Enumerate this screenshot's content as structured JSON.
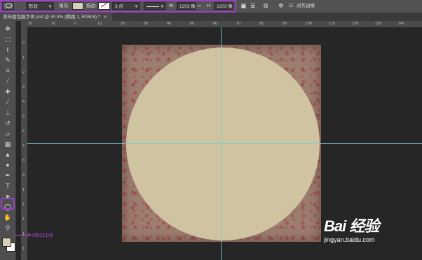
{
  "options_bar": {
    "shape_mode": "形状",
    "fill_label": "填充:",
    "stroke_label": "描边:",
    "stroke_size": "3 点",
    "width_label": "W:",
    "width_value": "1203 像",
    "link_icon": "link-icon",
    "height_label": "H:",
    "height_value": "1203 像",
    "align_edges_label": "对齐边缘",
    "fill_color": "#d8d1b9",
    "highlight_color": "#9b3fc4"
  },
  "document_tab": {
    "title": "美味面包圈字体.psd @ 40.3% (椭圆 1, RGB/8) *"
  },
  "ruler": {
    "h_ticks": [
      "20",
      "10",
      "0",
      "10",
      "20",
      "30",
      "40",
      "50",
      "60",
      "70",
      "80",
      "90",
      "100",
      "110",
      "120",
      "130",
      "140"
    ],
    "v_ticks": [
      "0",
      "1",
      "2",
      "3",
      "4",
      "5",
      "6",
      "7",
      "8",
      "9",
      "1",
      "1",
      "1",
      "1",
      "1"
    ]
  },
  "toolbar": {
    "tools": [
      "move-tool",
      "marquee-tool",
      "lasso-tool",
      "quick-select-tool",
      "crop-tool",
      "eyedropper-tool",
      "healing-brush-tool",
      "brush-tool",
      "clone-stamp-tool",
      "history-brush-tool",
      "eraser-tool",
      "gradient-tool",
      "blur-tool",
      "dodge-tool",
      "pen-tool",
      "type-tool",
      "path-select-tool",
      "ellipse-tool",
      "hand-tool",
      "zoom-tool"
    ],
    "selected_tool": "ellipse-tool",
    "foreground_color": "#d8d1b9",
    "background_color": "#ffffff"
  },
  "annotation": {
    "text": "#d8d1b9",
    "color": "#b03fd0"
  },
  "canvas": {
    "circle_color": "#cfc3a1",
    "guide_color": "#6fd0d0"
  },
  "watermark": {
    "logo": "Bai 经验",
    "url": "jingyan.baidu.com"
  }
}
